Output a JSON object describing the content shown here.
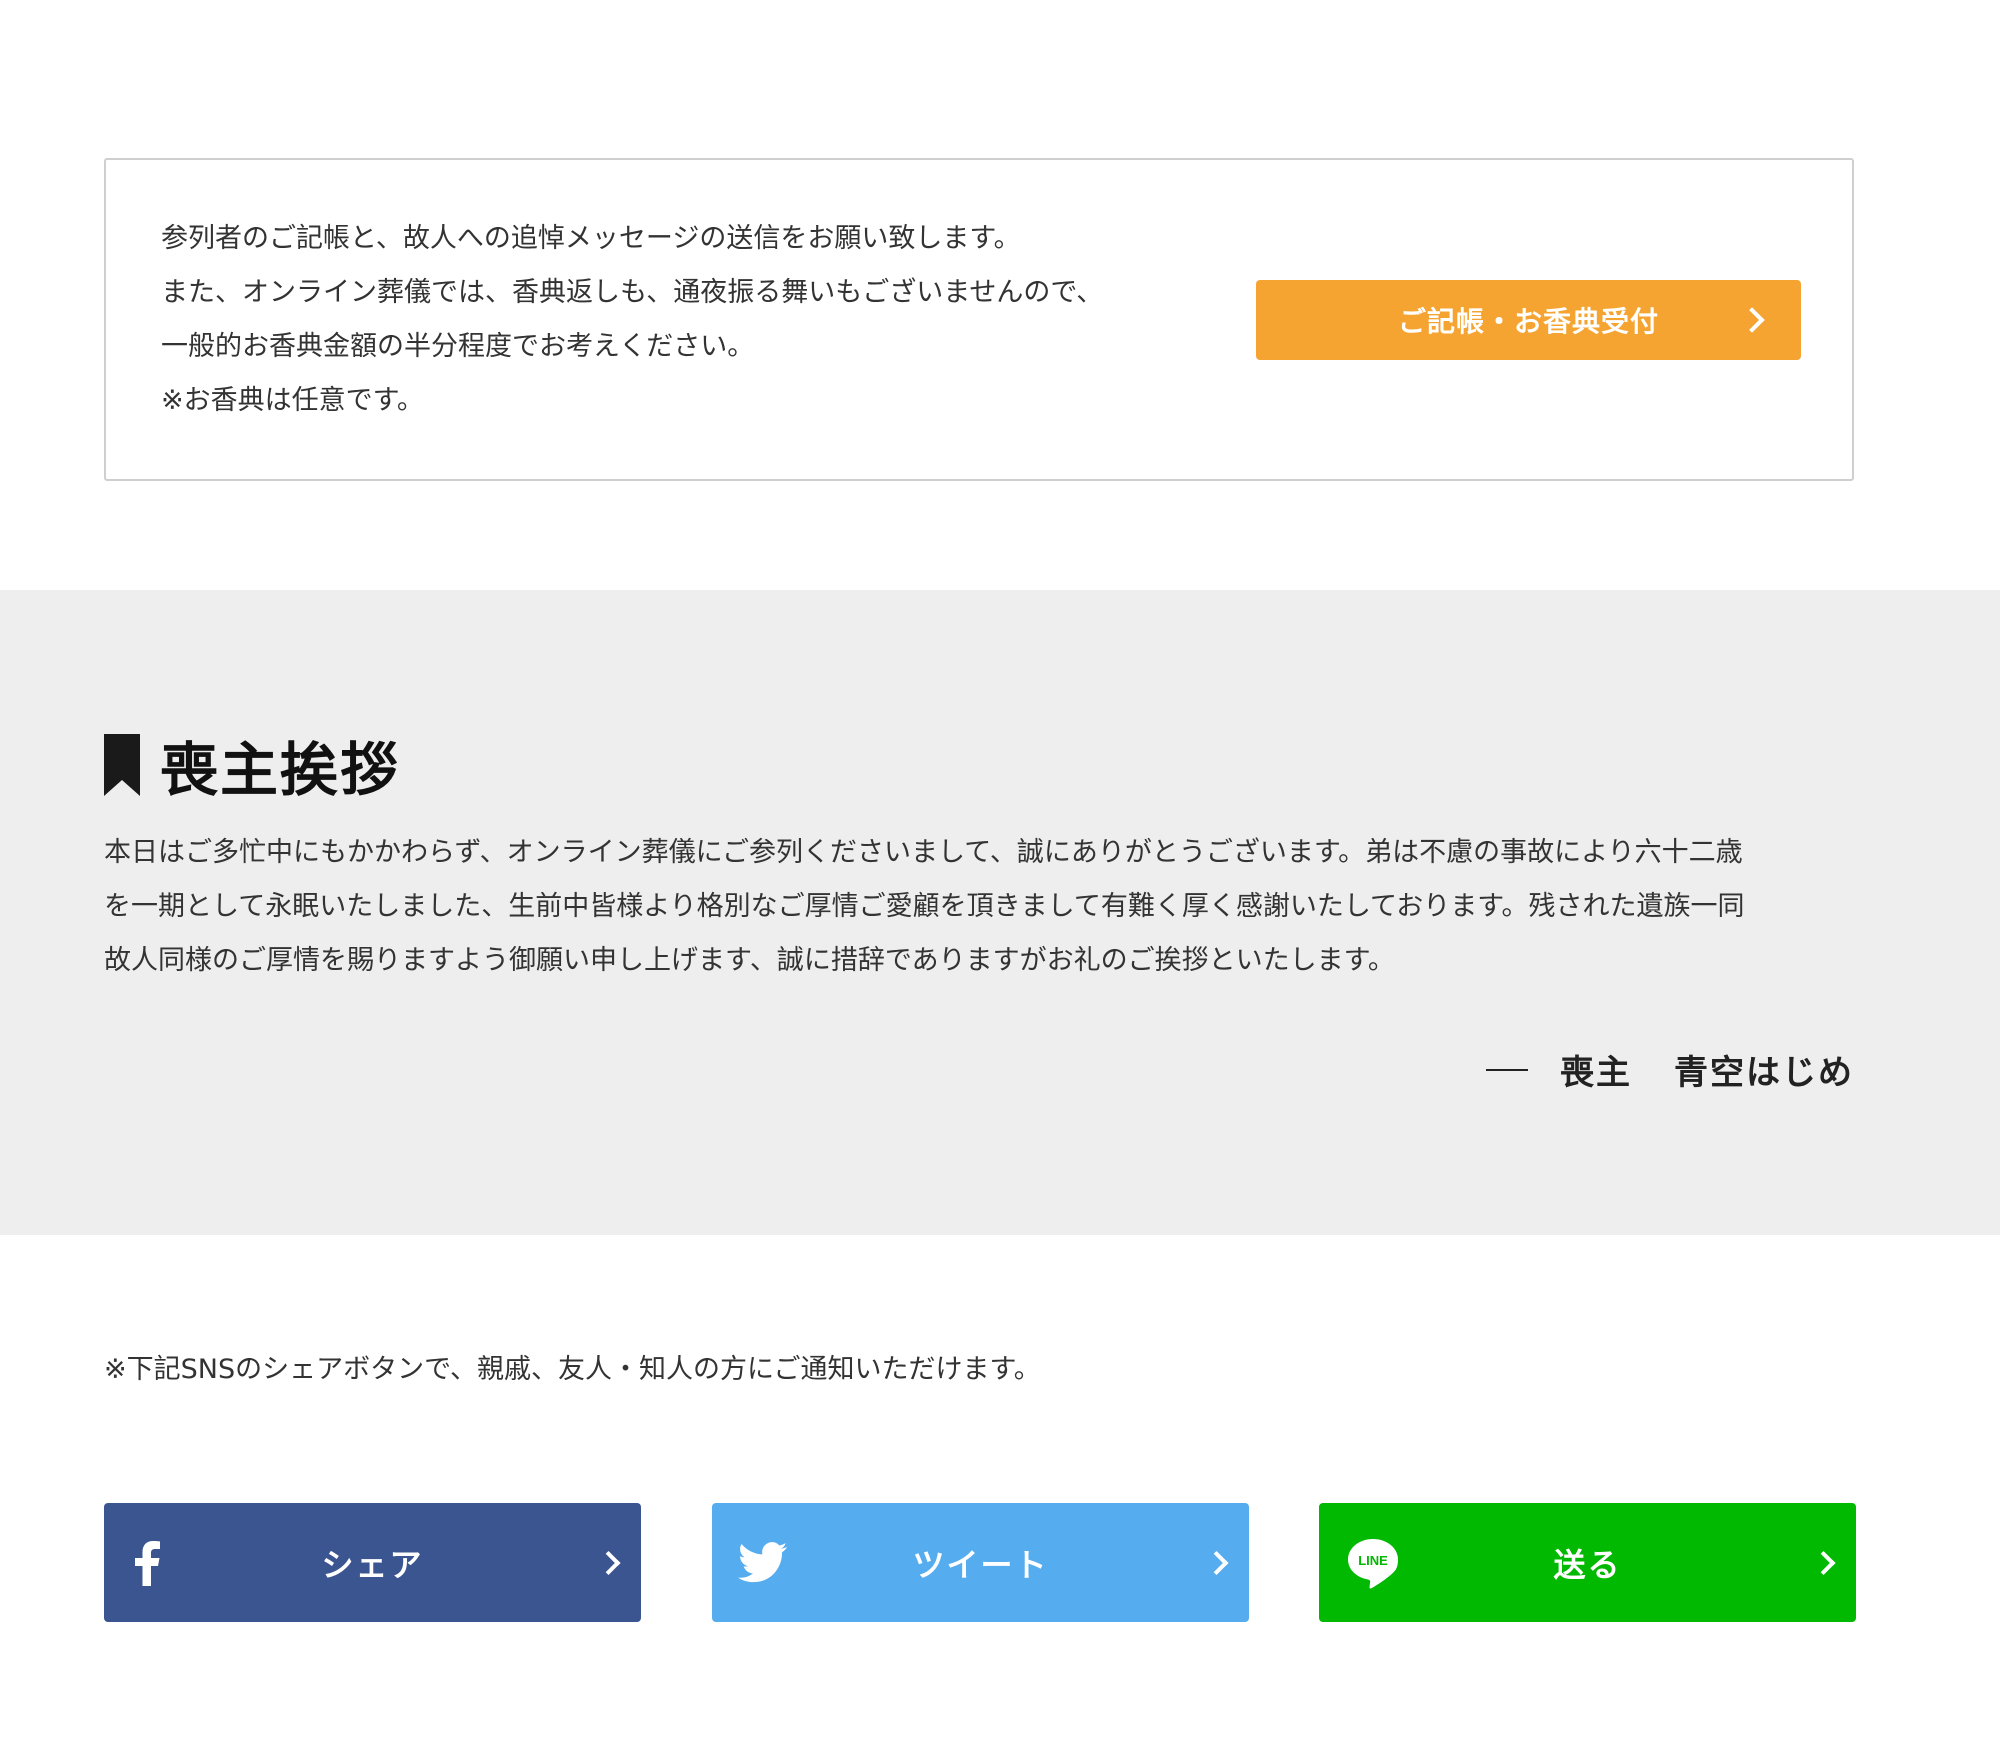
{
  "offering": {
    "lines": [
      "参列者のご記帳と、故人への追悼メッセージの送信をお願い致します。",
      "また、オンライン葬儀では、香典返しも、通夜振る舞いもございませんので、",
      "一般的お香典金額の半分程度でお考えください。",
      "※お香典は任意です。"
    ],
    "button_label": "ご記帳・お香典受付",
    "button_color": "#f5a432"
  },
  "greeting": {
    "title": "喪主挨拶",
    "body_lines": [
      "本日はご多忙中にもかかわらず、オンライン葬儀にご参列くださいまして、誠にありがとうございます。弟は不慮の事故により六十二歳",
      "を一期として永眠いたしました、生前中皆様より格別なご厚情ご愛顧を頂きまして有難く厚く感謝いたしております。残された遺族一同",
      "故人同様のご厚情を賜りますよう御願い申し上げます、誠に措辞でありますがお礼のご挨拶といたします。"
    ],
    "signature_role": "喪主",
    "signature_name": "青空はじめ",
    "background_color": "#eeeeee"
  },
  "sns": {
    "note": "※下記SNSのシェアボタンで、親戚、友人・知人の方にご通知いただけます。",
    "buttons": [
      {
        "label": "シェア",
        "icon": "facebook-icon",
        "color": "#3b5590"
      },
      {
        "label": "ツイート",
        "icon": "twitter-icon",
        "color": "#55acee"
      },
      {
        "label": "送る",
        "icon": "line-icon",
        "icon_text": "LINE",
        "color": "#00b900"
      }
    ]
  }
}
